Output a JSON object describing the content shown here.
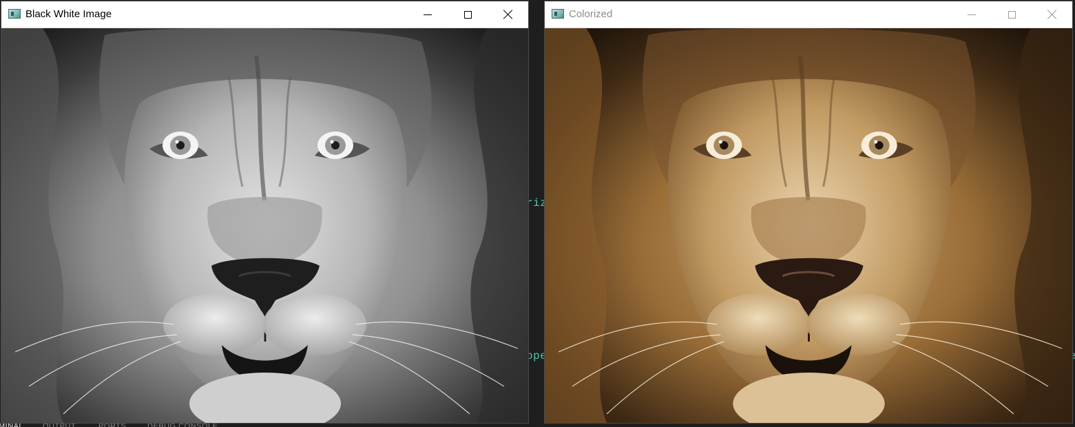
{
  "windows": [
    {
      "title": "Black White Image",
      "image": {
        "icon": "opencv-window-icon",
        "mode": "grayscale",
        "subject": "lion"
      }
    },
    {
      "title": "Colorized",
      "image": {
        "icon": "opencv-window-icon",
        "mode": "color",
        "subject": "lion"
      }
    }
  ],
  "background_editor": {
    "code_fragments": [
      "riz",
      "ope",
      "e"
    ],
    "panel_tabs": [
      "MINAL",
      "OUTPUT",
      "PORTS",
      "DEBUG CONSOLE"
    ]
  },
  "colors": {
    "editor_bg": "#1e1e1e",
    "code_green": "#4ec9b0",
    "gray_fur_light": "#d9d9d9",
    "gray_fur_dark": "#2b2b2b",
    "color_fur_light": "#e8cfa3",
    "color_fur_mid": "#b08548",
    "color_fur_dark": "#2a1d10"
  }
}
